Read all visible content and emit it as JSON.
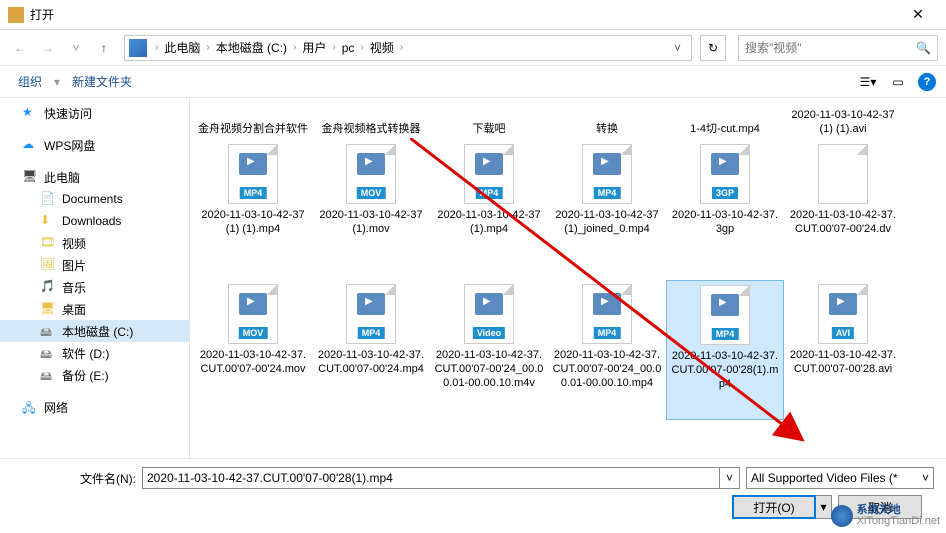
{
  "titlebar": {
    "title": "打开"
  },
  "breadcrumbs": [
    "此电脑",
    "本地磁盘 (C:)",
    "用户",
    "pc",
    "视频"
  ],
  "search": {
    "placeholder": "搜索\"视频\""
  },
  "toolbar": {
    "organize": "组织",
    "newfolder": "新建文件夹"
  },
  "sidebar": {
    "quick": "快速访问",
    "wps": "WPS网盘",
    "thispc": "此电脑",
    "documents": "Documents",
    "downloads": "Downloads",
    "videos": "视频",
    "pictures": "图片",
    "music": "音乐",
    "desktop": "桌面",
    "drive_c": "本地磁盘 (C:)",
    "drive_d": "软件 (D:)",
    "drive_e": "备份 (E:)",
    "network": "网络"
  },
  "files_partial": [
    {
      "label": "金舟视频分割合并软件"
    },
    {
      "label": "金舟视频格式转换器"
    },
    {
      "label": "下载吧"
    },
    {
      "label": "转换"
    },
    {
      "label": "1-4切-cut.mp4"
    },
    {
      "label": "2020-11-03-10-42-37(1) (1).avi"
    }
  ],
  "files_row2": [
    {
      "label": "2020-11-03-10-42-37(1) (1).mp4",
      "badge": "MP4",
      "cls": "b-mp4"
    },
    {
      "label": "2020-11-03-10-42-37(1).mov",
      "badge": "MOV",
      "cls": "b-mov"
    },
    {
      "label": "2020-11-03-10-42-37(1).mp4",
      "badge": "MP4",
      "cls": "b-mp4"
    },
    {
      "label": "2020-11-03-10-42-37(1)_joined_0.mp4",
      "badge": "MP4",
      "cls": "b-mp4"
    },
    {
      "label": "2020-11-03-10-42-37.3gp",
      "badge": "3GP",
      "cls": "b-3gp"
    },
    {
      "label": "2020-11-03-10-42-37.CUT.00'07-00'24.dv",
      "badge": "",
      "cls": "plain"
    }
  ],
  "files_row3": [
    {
      "label": "2020-11-03-10-42-37.CUT.00'07-00'24.mov",
      "badge": "MOV",
      "cls": "b-mov"
    },
    {
      "label": "2020-11-03-10-42-37.CUT.00'07-00'24.mp4",
      "badge": "MP4",
      "cls": "b-mp4"
    },
    {
      "label": "2020-11-03-10-42-37.CUT.00'07-00'24_00.00.01-00.00.10.m4v",
      "badge": "Video",
      "cls": "b-video"
    },
    {
      "label": "2020-11-03-10-42-37.CUT.00'07-00'24_00.00.01-00.00.10.mp4",
      "badge": "MP4",
      "cls": "b-mp4"
    },
    {
      "label": "2020-11-03-10-42-37.CUT.00'07-00'28(1).mp4",
      "badge": "MP4",
      "cls": "b-mp4",
      "selected": true
    },
    {
      "label": "2020-11-03-10-42-37.CUT.00'07-00'28.avi",
      "badge": "AVI",
      "cls": "b-avi"
    }
  ],
  "footer": {
    "filename_label": "文件名(N):",
    "filename_value": "2020-11-03-10-42-37.CUT.00'07-00'28(1).mp4",
    "filetype": "All Supported Video Files (*",
    "open": "打开(O)",
    "cancel": "取消"
  },
  "watermark": {
    "line1": "系统天地",
    "line2": "XiTongTianDi.net"
  }
}
